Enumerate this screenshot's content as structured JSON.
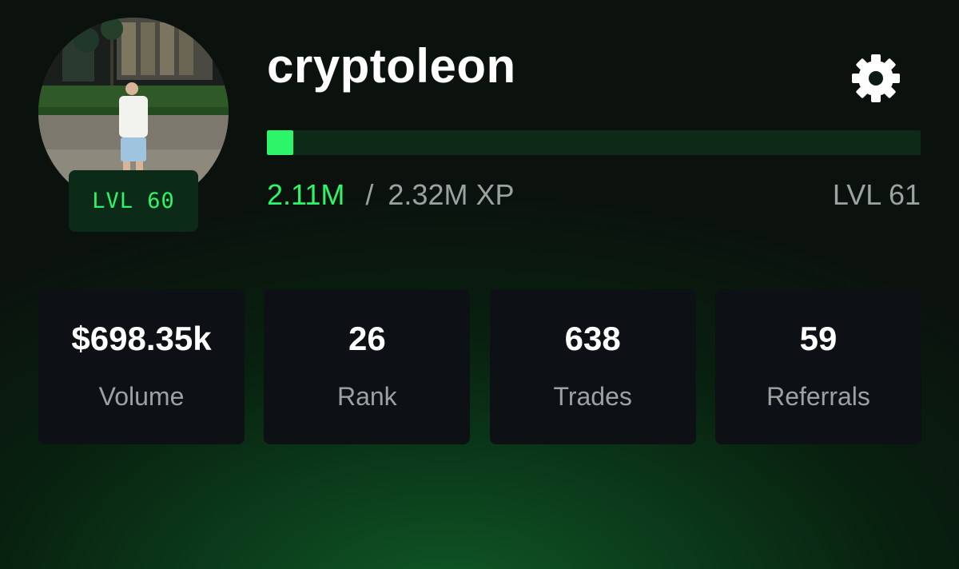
{
  "profile": {
    "username": "cryptoleon",
    "avatar_icon": "user-photo",
    "level_badge": "LVL 60",
    "settings_icon": "gear-icon"
  },
  "xp": {
    "current": "2.11M",
    "separator": "/",
    "total": "2.32M XP",
    "next_level": "LVL 61",
    "progress_fraction": 0.04
  },
  "stats": [
    {
      "value": "$698.35k",
      "label": "Volume"
    },
    {
      "value": "26",
      "label": "Rank"
    },
    {
      "value": "638",
      "label": "Trades"
    },
    {
      "value": "59",
      "label": "Referrals"
    }
  ],
  "colors": {
    "accent": "#2df56a",
    "card_bg": "#0d1115",
    "muted_text": "#9aa3a0"
  }
}
